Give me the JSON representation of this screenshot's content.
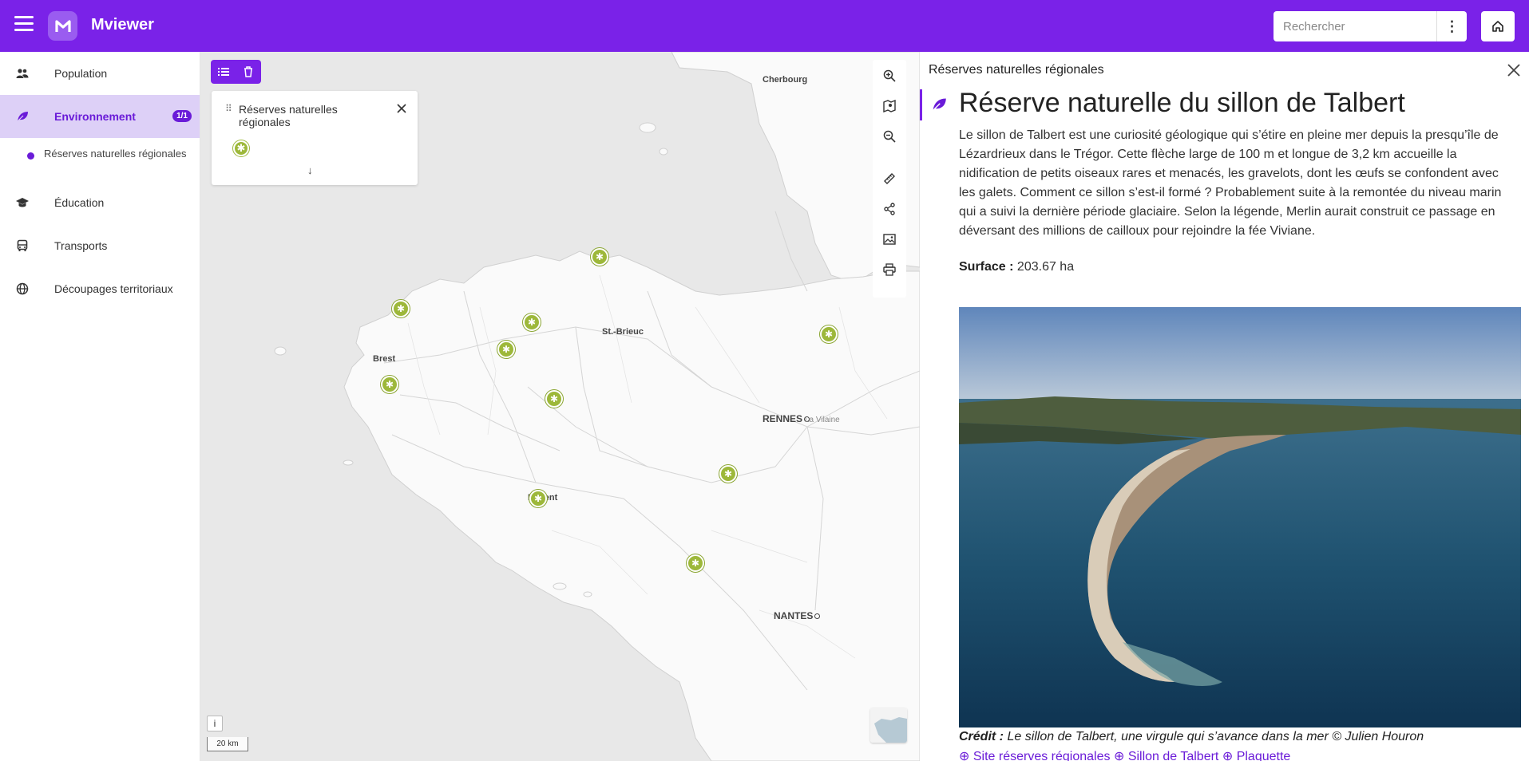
{
  "header": {
    "app_title": "Mviewer",
    "search_placeholder": "Rechercher",
    "brand_color": "#7a22e8"
  },
  "sidebar": {
    "items": [
      {
        "label": "Population",
        "icon": "users-icon"
      },
      {
        "label": "Environnement",
        "icon": "leaf-icon",
        "badge": "1/1",
        "active": true
      },
      {
        "label": "Éducation",
        "icon": "graduation-cap-icon"
      },
      {
        "label": "Transports",
        "icon": "bus-icon"
      },
      {
        "label": "Découpages territoriaux",
        "icon": "globe-icon"
      }
    ],
    "sub_item": "Réserves naturelles régionales"
  },
  "map": {
    "legend_title": "Réserves naturelles régionales",
    "scale_label": "20 km",
    "info_label": "i",
    "cities": {
      "cherbourg": "Cherbourg",
      "brest": "Brest",
      "st_brieuc": "St.-Brieuc",
      "rennes": "RENNES",
      "la_vilaine": "La Vilaine",
      "lorient": "Lorient",
      "nantes": "NANTES"
    },
    "marker_symbol": "✱",
    "marker_color": "#9db83a"
  },
  "panel": {
    "layer_title": "Réserves naturelles régionales",
    "feature_title": "Réserve naturelle du sillon de Talbert",
    "description": "Le sillon de Talbert est une curiosité géologique qui s’étire en pleine mer depuis la presqu’île de Lézardrieux dans le Trégor. Cette flèche large de 100 m et longue de 3,2 km accueille la nidification de petits oiseaux rares et menacés, les gravelots, dont les œufs se confondent avec les galets. Comment ce sillon s’est-il formé ? Probablement suite à la remontée du niveau marin qui a suivi la dernière période glaciaire. Selon la légende, Merlin aurait construit ce passage en déversant des millions de cailloux pour rejoindre la fée Viviane.",
    "surface_label": "Surface :",
    "surface_value": "203.67 ha",
    "credit_label": "Crédit :",
    "credit_text": "Le sillon de Talbert, une virgule qui s’avance dans la mer © Julien Houron",
    "links": [
      "Site réserves régionales",
      "Sillon de Talbert",
      "Plaquette"
    ]
  }
}
